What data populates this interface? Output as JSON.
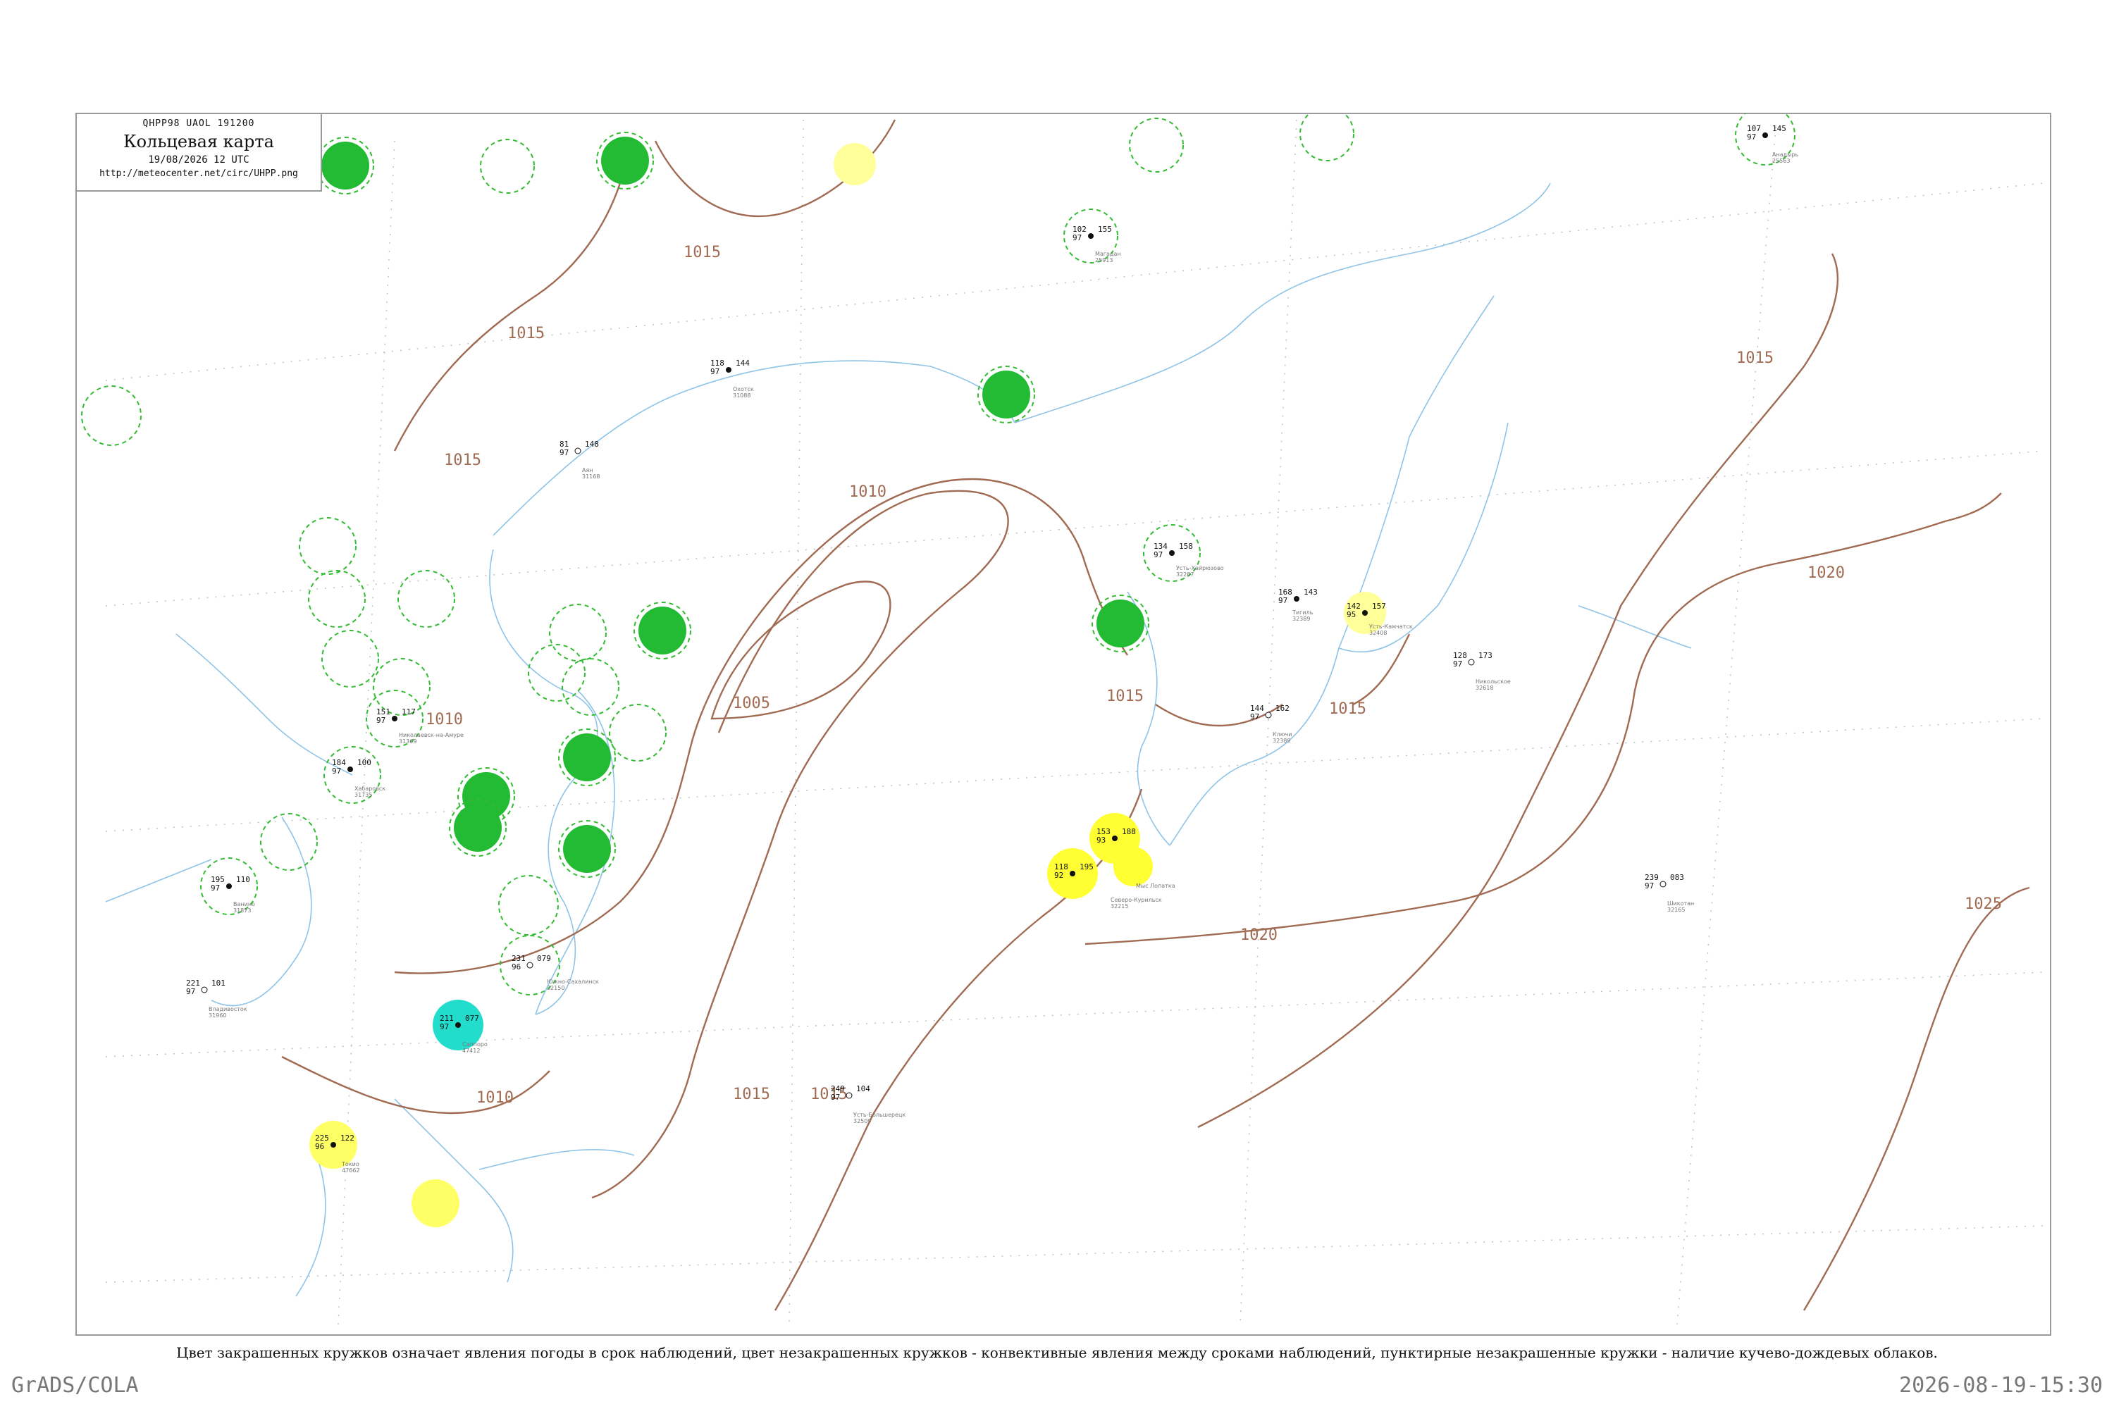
{
  "title": {
    "code": "QHPP98  UAOL  191200",
    "name": "Кольцевая карта",
    "datetime": "19/08/2026 12 UTC",
    "url": "http://meteocenter.net/circ/UHPP.png"
  },
  "footnote": "Цвет закрашенных кружков означает явления погоды в срок наблюдений, цвет незакрашенных кружков - конвективные явления между сроками наблюдений, пунктирные незакрашенные кружки - наличие кучево-дождевых облаков.",
  "footer": {
    "software": "GrADS/COLA",
    "timestamp": "2026-08-19-15:30"
  },
  "colors": {
    "isobar": "#a06b52",
    "coastline": "#8fc4e8",
    "precip_green": "#22bb33",
    "fog_yellow": "#ffff33",
    "light_yellow": "#ffff99",
    "cyan": "#22ddcc",
    "dashed_ring": "#33bb33"
  },
  "isobar_labels": [
    "1015",
    "1015",
    "1015",
    "1010",
    "1005",
    "1010",
    "1015",
    "1015",
    "1010",
    "1015",
    "1015",
    "1015",
    "1020",
    "1020",
    "1025"
  ],
  "stations": [
    {
      "name": "Тигиль",
      "id": "32389",
      "temp": "168",
      "pressure": "143",
      "dew": "97"
    },
    {
      "name": "Усть-Камчатск",
      "id": "32408",
      "temp": "142",
      "pressure": "157",
      "dew": "95"
    },
    {
      "name": "Ключи",
      "id": "32389",
      "temp": "144",
      "pressure": "162",
      "dew": "97"
    },
    {
      "name": "Никольское",
      "id": "32618",
      "temp": "128",
      "pressure": "173",
      "dew": "97"
    },
    {
      "name": "Усть-Хайрюзово",
      "id": "32287",
      "temp": "134",
      "pressure": "158",
      "dew": "97"
    },
    {
      "name": "Мыс Лопатка",
      "id": "32215",
      "temp": "153",
      "pressure": "188",
      "dew": "93"
    },
    {
      "name": "Северо-Курильск",
      "id": "32215",
      "temp": "118",
      "pressure": "195",
      "dew": "92"
    },
    {
      "name": "Охотск",
      "id": "31088",
      "temp": "118",
      "pressure": "144",
      "dew": "97"
    },
    {
      "name": "Аян",
      "id": "31168",
      "temp": "81",
      "pressure": "148",
      "dew": "97"
    },
    {
      "name": "Николаевск-на-Амуре",
      "id": "31369",
      "temp": "151",
      "pressure": "117",
      "dew": "97"
    },
    {
      "name": "Южно-Сахалинск",
      "id": "32150",
      "temp": "231",
      "pressure": "079",
      "dew": "96"
    },
    {
      "name": "Владивосток",
      "id": "31960",
      "temp": "221",
      "pressure": "101",
      "dew": "97"
    },
    {
      "name": "Хабаровск",
      "id": "31735",
      "temp": "184",
      "pressure": "100",
      "dew": "97"
    },
    {
      "name": "Магадан",
      "id": "25913",
      "temp": "102",
      "pressure": "155",
      "dew": "97"
    },
    {
      "name": "Анадырь",
      "id": "25563",
      "temp": "107",
      "pressure": "145",
      "dew": "97"
    },
    {
      "name": "Усть-Большерецк",
      "id": "32509",
      "temp": "249",
      "pressure": "104",
      "dew": "97"
    },
    {
      "name": "Ванино",
      "id": "31873",
      "temp": "195",
      "pressure": "110",
      "dew": "97"
    },
    {
      "name": "Токио",
      "id": "47662",
      "temp": "225",
      "pressure": "122",
      "dew": "96"
    },
    {
      "name": "Саппоро",
      "id": "47412",
      "temp": "211",
      "pressure": "077",
      "dew": "97"
    },
    {
      "name": "Шикотан",
      "id": "32165",
      "temp": "239",
      "pressure": "083",
      "dew": "97"
    }
  ]
}
